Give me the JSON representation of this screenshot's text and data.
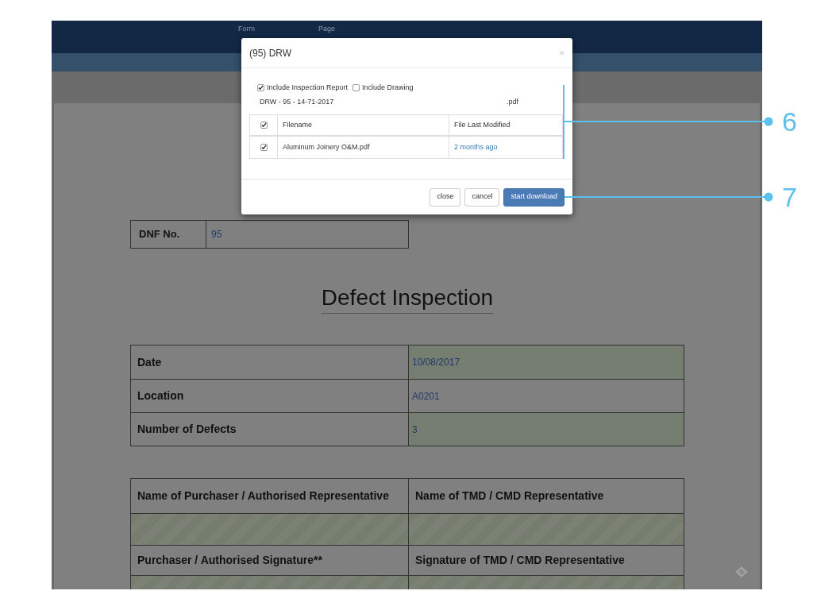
{
  "top_bar": {
    "labels": [
      "Form",
      "Page"
    ]
  },
  "modal": {
    "title": "(95) DRW",
    "close": "×",
    "options": [
      {
        "label": "Include Inspection Report",
        "checked": true
      },
      {
        "label": "Include Drawing",
        "checked": false
      }
    ],
    "filename": "DRW - 95 - 14-71-2017",
    "extension": ".pdf",
    "table": {
      "header_checked": true,
      "columns": [
        "Filename",
        "File Last Modified"
      ],
      "rows": [
        {
          "checked": true,
          "filename": "Aluminum Joinery O&M.pdf",
          "modified": "2 months ago"
        }
      ]
    },
    "buttons": [
      {
        "label": "close",
        "kind": "default"
      },
      {
        "label": "cancel",
        "kind": "default"
      },
      {
        "label": "start download",
        "kind": "primary"
      }
    ]
  },
  "document": {
    "dnf": {
      "label": "DNF No.",
      "value": "95"
    },
    "title": "Defect Inspection",
    "info_rows": [
      {
        "label": "Date",
        "value": "10/08/2017",
        "highlighted": true
      },
      {
        "label": "Location",
        "value": "A0201",
        "highlighted": false
      },
      {
        "label": "Number of Defects",
        "value": "3",
        "highlighted": true
      }
    ],
    "signature_rows": [
      {
        "kind": "header",
        "cells": [
          "Name of Purchaser / Authorised Representative",
          "Name of TMD / CMD Representative"
        ]
      },
      {
        "kind": "blank"
      },
      {
        "kind": "header",
        "cells": [
          "Purchaser / Authorised Signature**",
          "Signature of TMD / CMD Representative"
        ]
      },
      {
        "kind": "blank"
      }
    ]
  },
  "callouts": [
    "6",
    "7"
  ]
}
